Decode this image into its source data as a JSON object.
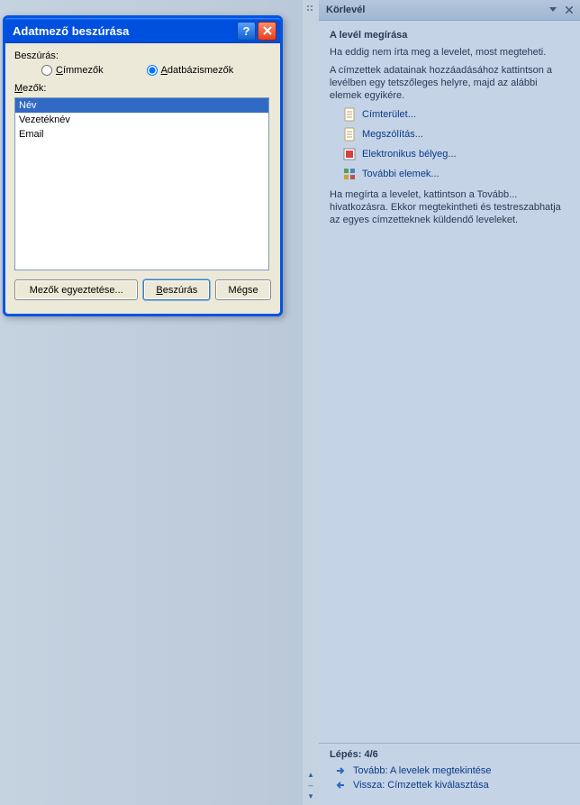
{
  "dialog": {
    "title": "Adatmező beszúrása",
    "insert_label": "Beszúrás:",
    "radio_address": "Címmezők",
    "radio_db": "Adatbázismezők",
    "fields_label": "Mezők:",
    "fields": [
      "Név",
      "Vezetéknév",
      "Email"
    ],
    "btn_match": "Mezők egyeztetése...",
    "btn_insert": "Beszúrás",
    "btn_cancel": "Mégse"
  },
  "pane": {
    "header": "Körlevél",
    "section_title": "A levél megírása",
    "text1": "Ha eddig nem írta meg a levelet, most megteheti.",
    "text2": "A címzettek adatainak hozzáadásához kattintson a levélben egy tetszőleges helyre, majd az alábbi elemek egyikére.",
    "links": {
      "address_block": "Címterület...",
      "greeting": "Megszólítás...",
      "postage": "Elektronikus bélyeg...",
      "more": "További elemek..."
    },
    "text3": "Ha megírta a levelet, kattintson a Tovább... hivatkozásra. Ekkor megtekintheti és testreszabhatja az egyes címzetteknek küldendő leveleket.",
    "step": "Lépés: 4/6",
    "next": "Tovább: A levelek megtekintése",
    "back": "Vissza: Címzettek kiválasztása"
  }
}
